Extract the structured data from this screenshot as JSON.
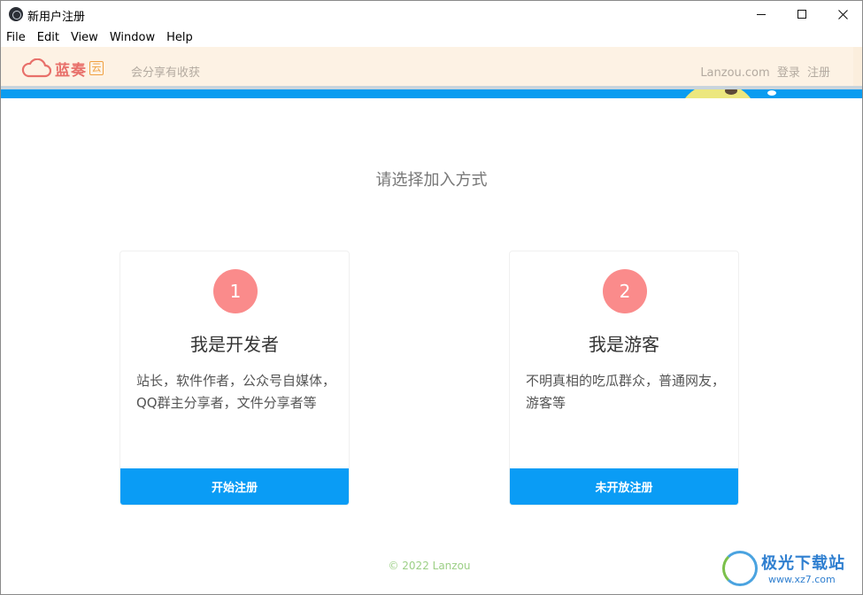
{
  "window": {
    "title": "新用户注册"
  },
  "menu": [
    "File",
    "Edit",
    "View",
    "Window",
    "Help"
  ],
  "header": {
    "logo_text": "蓝奏",
    "logo_badge": "云",
    "slogan": "会分享有收获",
    "site": "Lanzou.com",
    "login": "登录",
    "register": "注册"
  },
  "main": {
    "heading": "请选择加入方式",
    "cards": [
      {
        "number": "1",
        "title": "我是开发者",
        "description": "站长，软件作者，公众号自媒体，QQ群主分享者，文件分享者等",
        "button": "开始注册"
      },
      {
        "number": "2",
        "title": "我是游客",
        "description": "不明真相的吃瓜群众，普通网友，游客等",
        "button": "未开放注册"
      }
    ]
  },
  "footer": "© 2022 Lanzou",
  "watermark": {
    "name": "极光下载站",
    "url": "www.xz7.com"
  },
  "colors": {
    "accent": "#0a9cf5",
    "step_circle": "#fa8b8b",
    "header_bg": "#fdf2e4",
    "footer_text": "#9ccf86"
  }
}
